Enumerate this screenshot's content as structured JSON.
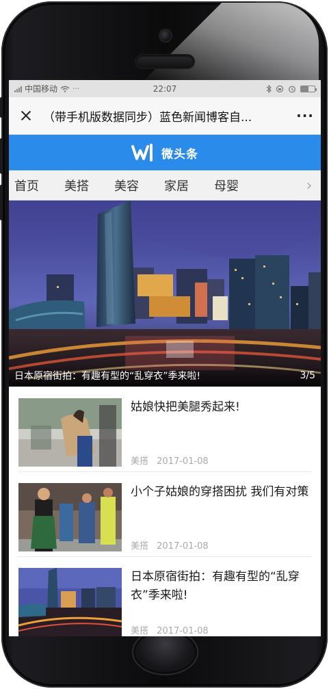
{
  "status_bar": {
    "carrier": "中国移动",
    "time": "22:07"
  },
  "title_bar": {
    "title": "（带手机版数据同步）蓝色新闻博客自...",
    "more": "···"
  },
  "brand": {
    "name": "微头条",
    "color": "#2a8bea"
  },
  "nav": {
    "items": [
      "首页",
      "美搭",
      "美容",
      "家居",
      "母婴"
    ]
  },
  "hero": {
    "caption": "日本原宿街拍：有趣有型的“乱穿衣”季来啦!",
    "pager": "3/5"
  },
  "articles": [
    {
      "title": "姑娘快把美腿秀起来!",
      "category": "美搭",
      "date": "2017-01-08"
    },
    {
      "title": "小个子姑娘的穿搭困扰 我们有对策",
      "category": "美搭",
      "date": "2017-01-08"
    },
    {
      "title": "日本原宿街拍：有趣有型的“乱穿衣”季来啦!",
      "category": "美搭",
      "date": "2017-01-08"
    }
  ]
}
